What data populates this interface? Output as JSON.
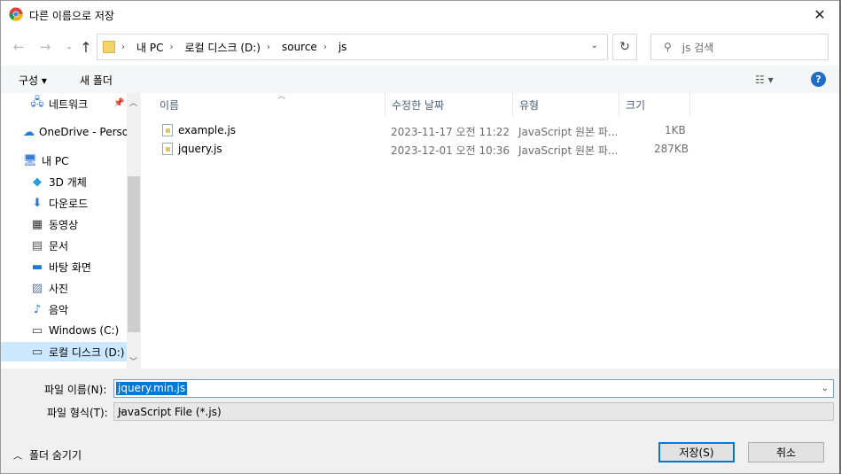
{
  "window": {
    "title": "다른 이름으로 저장",
    "close_glyph": "✕"
  },
  "nav": {
    "back_glyph": "←",
    "forward_glyph": "→",
    "recent_glyph": "⌄",
    "up_glyph": "↑",
    "breadcrumb": [
      "내 PC",
      "로컬 디스크 (D:)",
      "source",
      "js"
    ],
    "refresh_glyph": "↻",
    "search_placeholder": "js 검색"
  },
  "toolbar": {
    "organize_label": "구성 ▾",
    "new_folder_label": "새 폴더",
    "view_label": "☷ ▾",
    "help_label": "?"
  },
  "sidebar": {
    "items": [
      {
        "label": "네트워크",
        "icon": "network-icon"
      },
      {
        "label": "OneDrive - Person",
        "icon": "cloud-icon"
      },
      {
        "label": "내 PC",
        "icon": "pc-icon"
      },
      {
        "label": "3D 개체",
        "icon": "cube-icon"
      },
      {
        "label": "다운로드",
        "icon": "download-icon"
      },
      {
        "label": "동영상",
        "icon": "video-icon"
      },
      {
        "label": "문서",
        "icon": "document-icon"
      },
      {
        "label": "바탕 화면",
        "icon": "desktop-icon"
      },
      {
        "label": "사진",
        "icon": "picture-icon"
      },
      {
        "label": "음악",
        "icon": "music-icon"
      },
      {
        "label": "Windows (C:)",
        "icon": "drive-icon"
      },
      {
        "label": "로컬 디스크 (D:)",
        "icon": "drive-icon"
      }
    ]
  },
  "filelist": {
    "columns": [
      "이름",
      "수정한 날짜",
      "유형",
      "크기"
    ],
    "rows": [
      {
        "name": "example.js",
        "modified": "2023-11-17 오전 11:22",
        "type": "JavaScript 원본 파...",
        "size": "1KB"
      },
      {
        "name": "jquery.js",
        "modified": "2023-12-01 오전 10:36",
        "type": "JavaScript 원본 파...",
        "size": "287KB"
      }
    ]
  },
  "form": {
    "filename_label": "파일 이름(N):",
    "filename_value": "jquery.min.js",
    "filetype_label": "파일 형식(T):",
    "filetype_value": "JavaScript File (*.js)",
    "hide_folders_label": "폴더 숨기기",
    "save_label": "저장(S)",
    "cancel_label": "취소"
  }
}
